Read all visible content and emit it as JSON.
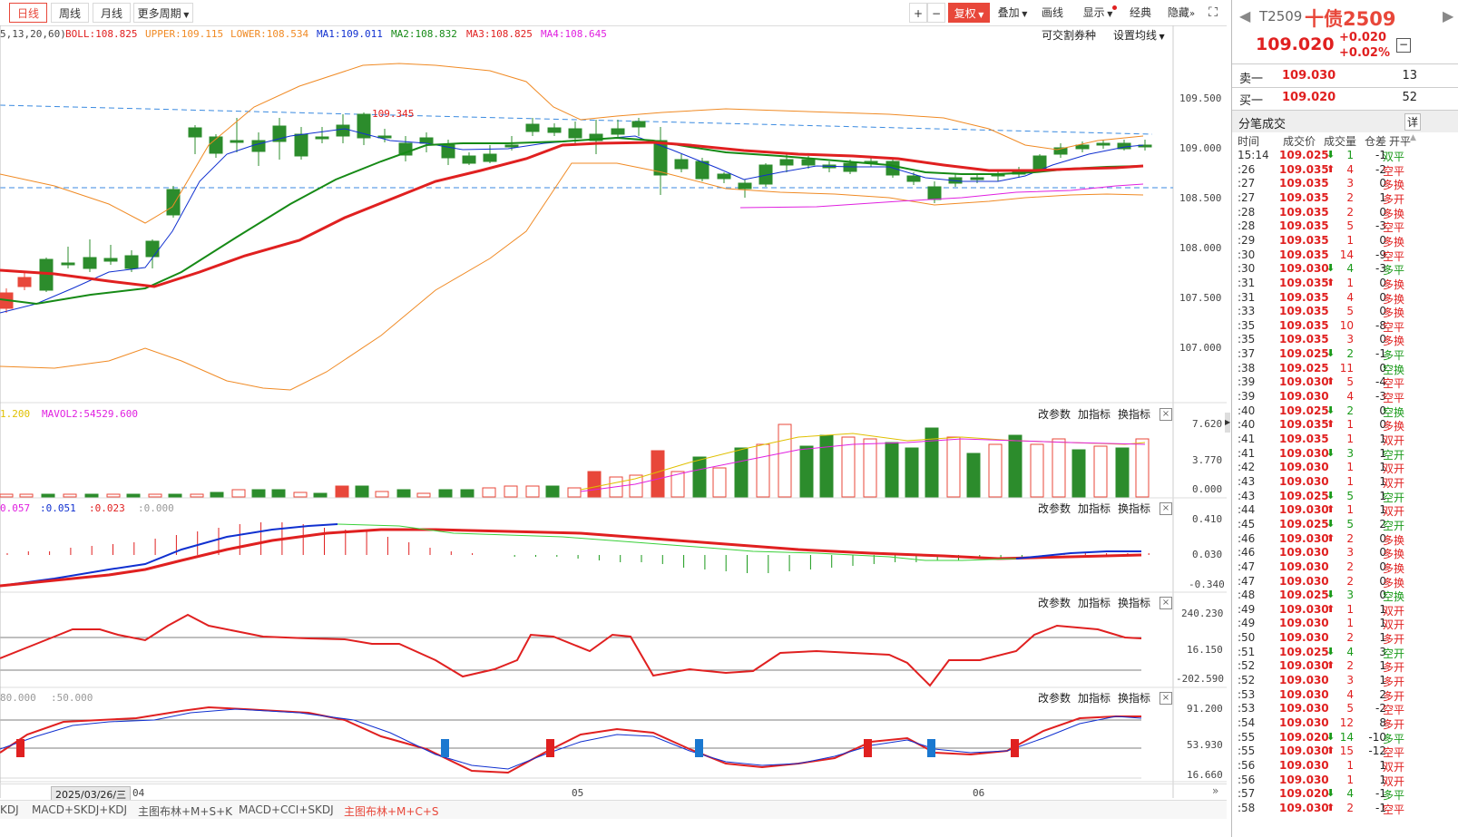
{
  "toolbar": {
    "periods": [
      "日线",
      "周线",
      "月线"
    ],
    "more_period": "更多周期",
    "fuquan": "复权",
    "overlay": "叠加",
    "draw": "画线",
    "display": "显示",
    "classic": "经典",
    "hide": "隐藏"
  },
  "main_params": {
    "prefix": "5,13,20,60)",
    "items": [
      {
        "label": "BOLL:108.825",
        "color": "#e02020"
      },
      {
        "label": "UPPER:109.115",
        "color": "#f08a24"
      },
      {
        "label": "LOWER:108.534",
        "color": "#f08a24"
      },
      {
        "label": "MA1:109.011",
        "color": "#1030d0"
      },
      {
        "label": "MA2:108.832",
        "color": "#168a16"
      },
      {
        "label": "MA3:108.825",
        "color": "#e02020"
      },
      {
        "label": "MA4:108.645",
        "color": "#e020e0"
      }
    ],
    "right1": "可交割券种",
    "right2": "设置均线"
  },
  "price_axis": [
    "109.500",
    "109.000",
    "108.500",
    "108.000",
    "107.500",
    "107.000"
  ],
  "high_label": "109.345",
  "vol_params": {
    "l1": "1.200",
    "l2": "MAVOL2:54529.600"
  },
  "vol_axis": [
    "7.620",
    "3.770",
    "0.000"
  ],
  "macd_params": {
    "l1": "0.057",
    "l2": ":0.051",
    "l3": ":0.023",
    "l4": ":0.000"
  },
  "macd_axis": [
    "0.410",
    "0.030",
    "-0.340"
  ],
  "cci_axis": [
    "240.230",
    "16.150",
    "-202.590"
  ],
  "kdj_params": {
    "l1": "80.000",
    "l2": ":50.000"
  },
  "kdj_axis": [
    "91.200",
    "53.930",
    "16.660"
  ],
  "panel_ctrl": {
    "a": "改参数",
    "b": "加指标",
    "c": "换指标"
  },
  "dates": {
    "cursor": "2025/03/26/三",
    "d04": "04",
    "d05": "05",
    "d06": "06"
  },
  "bottom_tabs": [
    "KDJ",
    "MACD+SKDJ+KDJ",
    "主图布林+M+S+K",
    "MACD+CCI+SKDJ",
    "主图布林+M+C+S"
  ],
  "quote": {
    "code": "T2509",
    "name": "十债2509",
    "price": "109.020",
    "chg": "+0.020",
    "pct": "+0.02%",
    "sell_label": "卖一",
    "sell_price": "109.030",
    "sell_vol": "13",
    "buy_label": "买一",
    "buy_price": "109.020",
    "buy_vol": "52",
    "ticks_title": "分笔成交",
    "detail_btn": "详",
    "head": [
      "时间",
      "成交价",
      "成交量",
      "仓差",
      "开平"
    ]
  },
  "ticks": [
    {
      "t": "15:14",
      "p": "109.025",
      "d": "down",
      "v": "1",
      "c": "-1",
      "k": "双平"
    },
    {
      "t": ":26",
      "p": "109.035",
      "d": "up",
      "v": "4",
      "c": "-2",
      "k": "空平"
    },
    {
      "t": ":27",
      "p": "109.035",
      "d": "",
      "v": "3",
      "c": "0",
      "k": "多换"
    },
    {
      "t": ":27",
      "p": "109.035",
      "d": "",
      "v": "2",
      "c": "1",
      "k": "多开"
    },
    {
      "t": ":28",
      "p": "109.035",
      "d": "",
      "v": "2",
      "c": "0",
      "k": "多换"
    },
    {
      "t": ":28",
      "p": "109.035",
      "d": "",
      "v": "5",
      "c": "-3",
      "k": "空平"
    },
    {
      "t": ":29",
      "p": "109.035",
      "d": "",
      "v": "1",
      "c": "0",
      "k": "多换"
    },
    {
      "t": ":30",
      "p": "109.035",
      "d": "",
      "v": "14",
      "c": "-9",
      "k": "空平"
    },
    {
      "t": ":30",
      "p": "109.030",
      "d": "down",
      "v": "4",
      "c": "-3",
      "k": "多平"
    },
    {
      "t": ":31",
      "p": "109.035",
      "d": "up",
      "v": "1",
      "c": "0",
      "k": "多换"
    },
    {
      "t": ":31",
      "p": "109.035",
      "d": "",
      "v": "4",
      "c": "0",
      "k": "多换"
    },
    {
      "t": ":33",
      "p": "109.035",
      "d": "",
      "v": "5",
      "c": "0",
      "k": "多换"
    },
    {
      "t": ":35",
      "p": "109.035",
      "d": "",
      "v": "10",
      "c": "-8",
      "k": "空平"
    },
    {
      "t": ":35",
      "p": "109.035",
      "d": "",
      "v": "3",
      "c": "0",
      "k": "多换"
    },
    {
      "t": ":37",
      "p": "109.025",
      "d": "down",
      "v": "2",
      "c": "-1",
      "k": "多平"
    },
    {
      "t": ":38",
      "p": "109.025",
      "d": "",
      "v": "11",
      "c": "0",
      "k": "空换"
    },
    {
      "t": ":39",
      "p": "109.030",
      "d": "up",
      "v": "5",
      "c": "-4",
      "k": "空平"
    },
    {
      "t": ":39",
      "p": "109.030",
      "d": "",
      "v": "4",
      "c": "-3",
      "k": "空平"
    },
    {
      "t": ":40",
      "p": "109.025",
      "d": "down",
      "v": "2",
      "c": "0",
      "k": "空换"
    },
    {
      "t": ":40",
      "p": "109.035",
      "d": "up",
      "v": "1",
      "c": "0",
      "k": "多换"
    },
    {
      "t": ":41",
      "p": "109.035",
      "d": "",
      "v": "1",
      "c": "1",
      "k": "双开"
    },
    {
      "t": ":41",
      "p": "109.030",
      "d": "down",
      "v": "3",
      "c": "1",
      "k": "空开"
    },
    {
      "t": ":42",
      "p": "109.030",
      "d": "",
      "v": "1",
      "c": "1",
      "k": "双开"
    },
    {
      "t": ":43",
      "p": "109.030",
      "d": "",
      "v": "1",
      "c": "1",
      "k": "双开"
    },
    {
      "t": ":43",
      "p": "109.025",
      "d": "down",
      "v": "5",
      "c": "1",
      "k": "空开"
    },
    {
      "t": ":44",
      "p": "109.030",
      "d": "up",
      "v": "1",
      "c": "1",
      "k": "双开"
    },
    {
      "t": ":45",
      "p": "109.025",
      "d": "down",
      "v": "5",
      "c": "2",
      "k": "空开"
    },
    {
      "t": ":46",
      "p": "109.030",
      "d": "up",
      "v": "2",
      "c": "0",
      "k": "多换"
    },
    {
      "t": ":46",
      "p": "109.030",
      "d": "",
      "v": "3",
      "c": "0",
      "k": "多换"
    },
    {
      "t": ":47",
      "p": "109.030",
      "d": "",
      "v": "2",
      "c": "0",
      "k": "多换"
    },
    {
      "t": ":47",
      "p": "109.030",
      "d": "",
      "v": "2",
      "c": "0",
      "k": "多换"
    },
    {
      "t": ":48",
      "p": "109.025",
      "d": "down",
      "v": "3",
      "c": "0",
      "k": "空换"
    },
    {
      "t": ":49",
      "p": "109.030",
      "d": "up",
      "v": "1",
      "c": "1",
      "k": "双开"
    },
    {
      "t": ":49",
      "p": "109.030",
      "d": "",
      "v": "1",
      "c": "1",
      "k": "双开"
    },
    {
      "t": ":50",
      "p": "109.030",
      "d": "",
      "v": "2",
      "c": "1",
      "k": "多开"
    },
    {
      "t": ":51",
      "p": "109.025",
      "d": "down",
      "v": "4",
      "c": "3",
      "k": "空开"
    },
    {
      "t": ":52",
      "p": "109.030",
      "d": "up",
      "v": "2",
      "c": "1",
      "k": "多开"
    },
    {
      "t": ":52",
      "p": "109.030",
      "d": "",
      "v": "3",
      "c": "1",
      "k": "多开"
    },
    {
      "t": ":53",
      "p": "109.030",
      "d": "",
      "v": "4",
      "c": "2",
      "k": "多开"
    },
    {
      "t": ":53",
      "p": "109.030",
      "d": "",
      "v": "5",
      "c": "-2",
      "k": "空平"
    },
    {
      "t": ":54",
      "p": "109.030",
      "d": "",
      "v": "12",
      "c": "8",
      "k": "多开"
    },
    {
      "t": ":55",
      "p": "109.020",
      "d": "down",
      "v": "14",
      "c": "-10",
      "k": "多平"
    },
    {
      "t": ":55",
      "p": "109.030",
      "d": "up",
      "v": "15",
      "c": "-12",
      "k": "空平"
    },
    {
      "t": ":56",
      "p": "109.030",
      "d": "",
      "v": "1",
      "c": "1",
      "k": "双开"
    },
    {
      "t": ":56",
      "p": "109.030",
      "d": "",
      "v": "1",
      "c": "1",
      "k": "双开"
    },
    {
      "t": ":57",
      "p": "109.020",
      "d": "down",
      "v": "4",
      "c": "-1",
      "k": "多平"
    },
    {
      "t": ":58",
      "p": "109.030",
      "d": "up",
      "v": "2",
      "c": "-1",
      "k": "空平"
    }
  ]
}
